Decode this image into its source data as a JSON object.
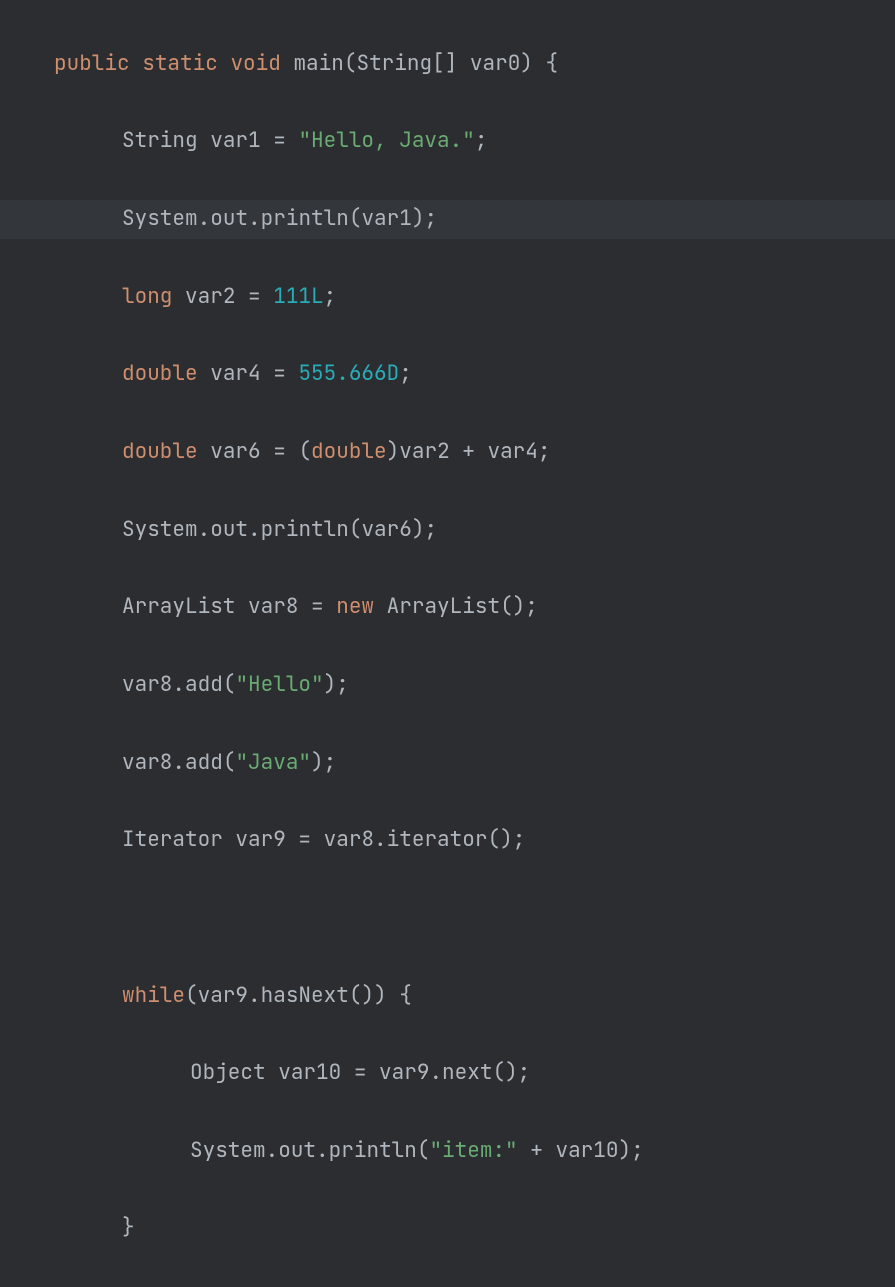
{
  "code": {
    "l1": {
      "kw1": "public",
      "kw2": "static",
      "kw3": "void",
      "fn": "main",
      "p1": "(",
      "type": "String",
      "arr": "[] ",
      "var": "var0",
      "p2": ")",
      "brace": " {"
    },
    "l2": {
      "type": "String",
      "var": "var1",
      "op": " = ",
      "str": "\"Hello, Java.\"",
      "semi": ";"
    },
    "l3": {
      "sys": "System",
      "dot1": ".",
      "out": "out",
      "dot2": ".",
      "fn": "println",
      "p1": "(",
      "arg": "var1",
      "p2": ")",
      "semi": ";"
    },
    "l4": {
      "kw": "long",
      "var": "var2",
      "op": " = ",
      "num": "111L",
      "semi": ";"
    },
    "l5": {
      "kw": "double",
      "var": "var4",
      "op": " = ",
      "num": "555.666D",
      "semi": ";"
    },
    "l6": {
      "kw": "double",
      "var": "var6",
      "op": " = ",
      "p1": "(",
      "cast": "double",
      "p2": ")",
      "a1": "var2",
      "plus": " + ",
      "a2": "var4",
      "semi": ";"
    },
    "l7": {
      "sys": "System",
      "dot1": ".",
      "out": "out",
      "dot2": ".",
      "fn": "println",
      "p1": "(",
      "arg": "var6",
      "p2": ")",
      "semi": ";"
    },
    "l8": {
      "type": "ArrayList",
      "var": "var8",
      "op": " = ",
      "kw": "new",
      "ctor": "ArrayList",
      "p1": "(",
      "p2": ")",
      "semi": ";"
    },
    "l9": {
      "obj": "var8",
      "dot": ".",
      "fn": "add",
      "p1": "(",
      "str": "\"Hello\"",
      "p2": ")",
      "semi": ";"
    },
    "l10": {
      "obj": "var8",
      "dot": ".",
      "fn": "add",
      "p1": "(",
      "str": "\"Java\"",
      "p2": ")",
      "semi": ";"
    },
    "l11": {
      "type": "Iterator",
      "var": "var9",
      "op": " = ",
      "obj": "var8",
      "dot": ".",
      "fn": "iterator",
      "p1": "(",
      "p2": ")",
      "semi": ";"
    },
    "l12": {
      "blank": ""
    },
    "l13": {
      "kw": "while",
      "p1": "(",
      "obj": "var9",
      "dot": ".",
      "fn": "hasNext",
      "p2": "(",
      "p3": ")",
      "p4": ")",
      "brace": " {"
    },
    "l14": {
      "type": "Object",
      "var": "var10",
      "op": " = ",
      "obj": "var9",
      "dot": ".",
      "fn": "next",
      "p1": "(",
      "p2": ")",
      "semi": ";"
    },
    "l15": {
      "sys": "System",
      "dot1": ".",
      "out": "out",
      "dot2": ".",
      "fn": "println",
      "p1": "(",
      "str": "\"item:\"",
      "plus": " + ",
      "arg": "var10",
      "p2": ")",
      "semi": ";"
    },
    "l16": {
      "brace": "}"
    }
  }
}
